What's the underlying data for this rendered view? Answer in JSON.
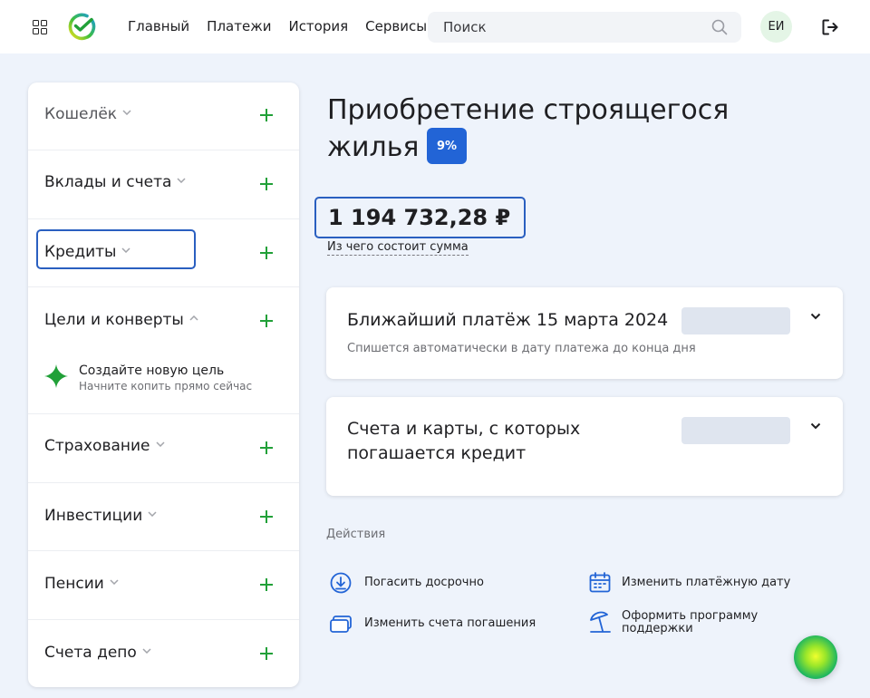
{
  "header": {
    "nav": [
      "Главный",
      "Платежи",
      "История",
      "Сервисы"
    ],
    "search_placeholder": "Поиск",
    "avatar_initials": "ЕИ"
  },
  "sidebar": {
    "items": [
      {
        "label": "Кошелёк",
        "expanded": false
      },
      {
        "label": "Вклады и счета",
        "expanded": false
      },
      {
        "label": "Кредиты",
        "expanded": false
      },
      {
        "label": "Цели и конверты",
        "expanded": true
      },
      {
        "label": "Страхование",
        "expanded": false
      },
      {
        "label": "Инвестиции",
        "expanded": false
      },
      {
        "label": "Пенсии",
        "expanded": false
      },
      {
        "label": "Счета депо",
        "expanded": false
      }
    ],
    "goal_title": "Создайте новую цель",
    "goal_subtitle": "Начните копить прямо сейчас"
  },
  "main": {
    "title": "Приобретение строящегося жилья",
    "rate_badge": "9%",
    "amount": "1 194 732,28 ₽",
    "breakdown_link": "Из чего состоит сумма",
    "next_payment_title": "Ближайший платёж 15 марта 2024",
    "next_payment_subtitle": "Спишется автоматически в дату платежа до конца дня",
    "accounts_title": "Счета и карты, с которых погашается кредит",
    "actions_title": "Действия",
    "actions": [
      "Погасить досрочно",
      "Изменить платёжную дату",
      "Изменить счета погашения",
      "Оформить программу поддержки"
    ]
  },
  "colors": {
    "accent_green": "#21a038",
    "accent_blue": "#2264d6",
    "page_bg": "#eef3fb"
  }
}
